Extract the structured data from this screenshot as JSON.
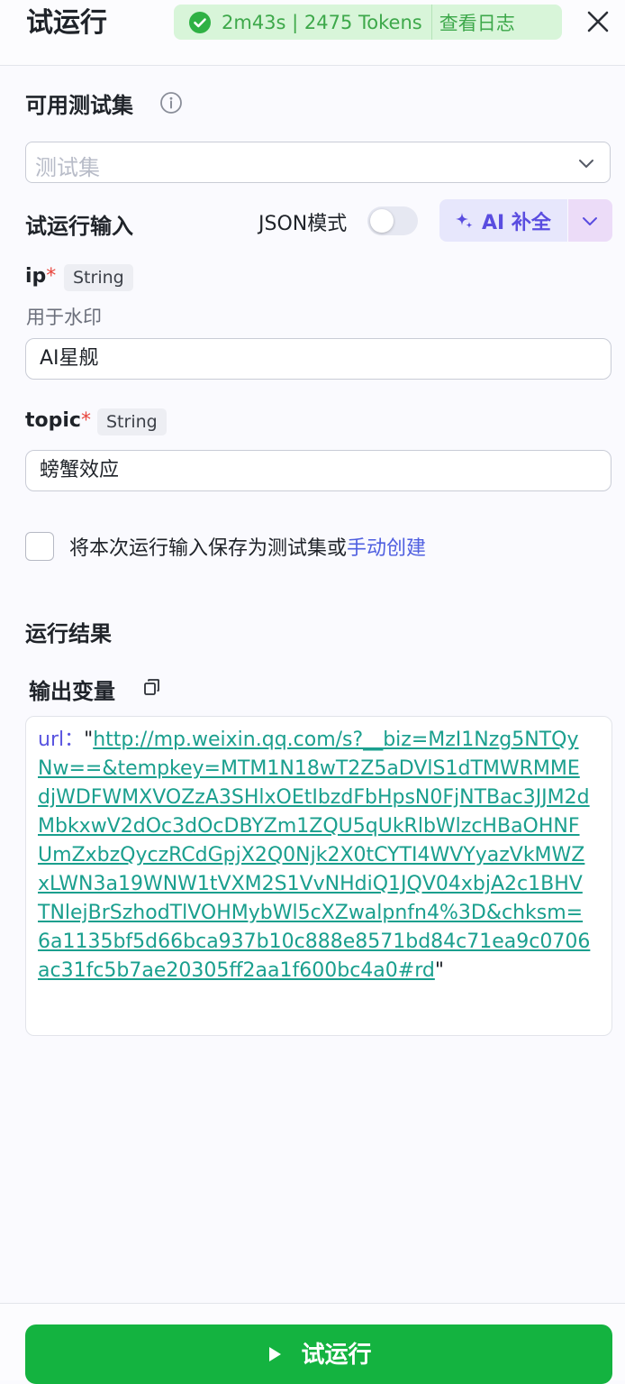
{
  "header": {
    "title": "试运行",
    "status_text": "2m43s | 2475 Tokens",
    "log_link": "查看日志"
  },
  "test_set": {
    "title": "可用测试集",
    "placeholder": "测试集"
  },
  "input_section": {
    "title": "试运行输入",
    "json_mode_label": "JSON模式",
    "json_mode_on": false,
    "ai_button_label": "AI 补全"
  },
  "fields": [
    {
      "name": "ip",
      "required_mark": "*",
      "type": "String",
      "description": "用于水印",
      "value": "AI星舰"
    },
    {
      "name": "topic",
      "required_mark": "*",
      "type": "String",
      "value": "螃蟹效应"
    }
  ],
  "save_option": {
    "text": "将本次运行输入保存为测试集或",
    "link": "手动创建"
  },
  "result": {
    "title": "运行结果",
    "output_title": "输出变量",
    "output_key": "url：",
    "output_value": "http://mp.weixin.qq.com/s?__biz=MzI1Nzg5NTQyNw==&tempkey=MTM1N18wT2Z5aDVlS1dTMWRMMEdjWDFWMXVOZzA3SHlxOEtIbzdFbHpsN0FjNTBac3JJM2dMbkxwV2dOc3dOcDBYZm1ZQU5qUkRlbWlzcHBaOHNFUmZxbzQyczRCdGpjX2Q0Njk2X0tCYTI4WVYyazVkMWZxLWN3a19WNW1tVXM2S1VvNHdiQ1JQV04xbjA2c1BHVTNlejBrSzhodTlVOHMybWl5cXZwalpnfn4%3D&chksm=6a1135bf5d66bca937b10c888e8571bd84c71ea9c0706ac31fc5b7ae20305ff2aa1f600bc4a0#rd"
  },
  "footer": {
    "run_label": "试运行"
  },
  "colors": {
    "primary_green": "#14b340",
    "status_green": "#3da84a",
    "accent_purple": "#5a4de0",
    "required_red": "#e8453c",
    "link_blue": "#4f5fe0",
    "url_teal": "#1a9f8e"
  }
}
